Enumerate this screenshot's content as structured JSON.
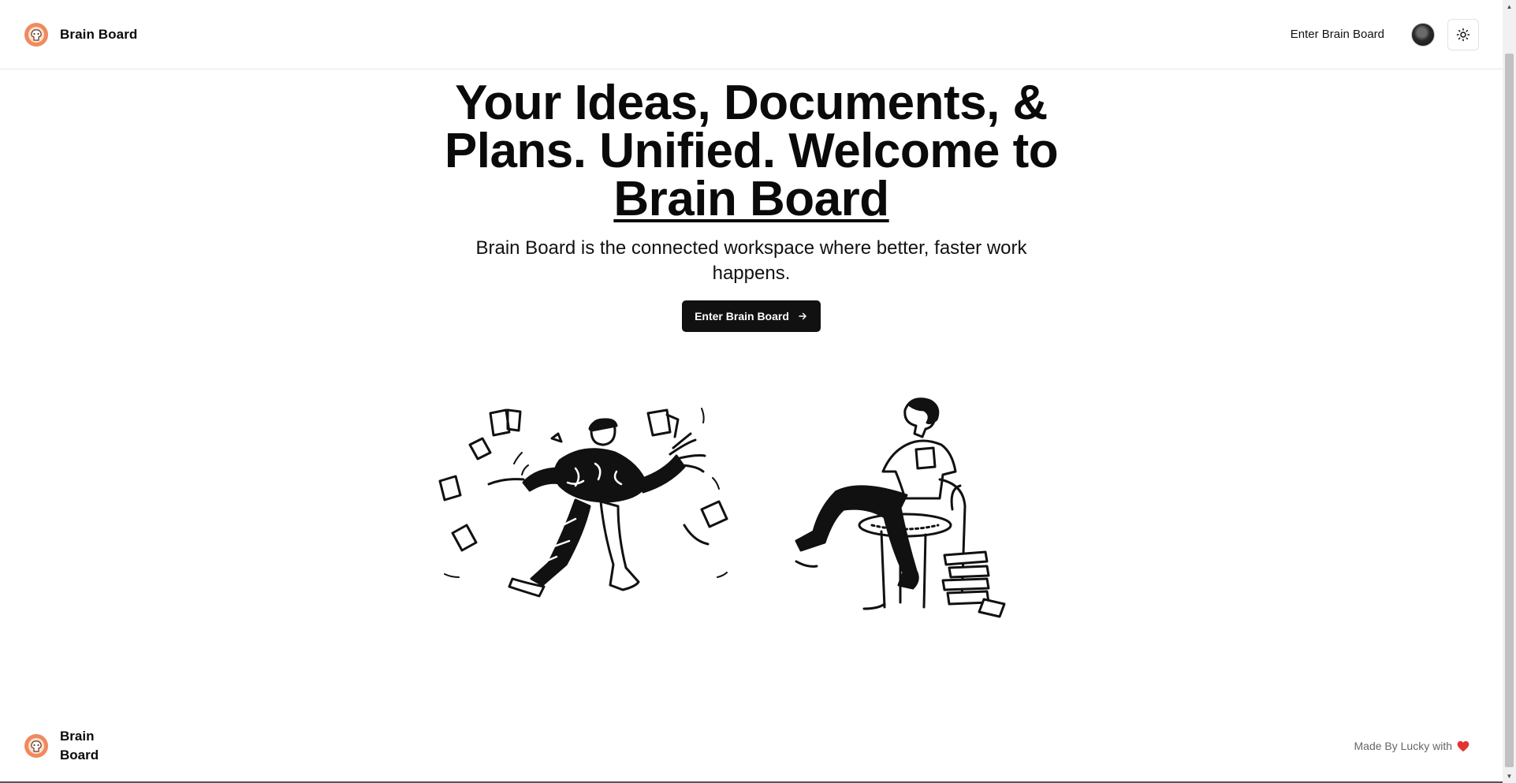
{
  "header": {
    "brand_name": "Brain Board",
    "nav_link": "Enter Brain Board"
  },
  "hero": {
    "title_main": "Your Ideas, Documents, & Plans. Unified. Welcome to ",
    "title_highlight": "Brain Board",
    "subtitle": "Brain Board is the connected workspace where better, faster work happens.",
    "cta_label": "Enter Brain Board"
  },
  "footer": {
    "brand_name": "Brain Board",
    "made_by": "Made By Lucky with"
  },
  "icons": {
    "logo": "brain-logo-icon",
    "theme": "sun-icon",
    "cta_arrow": "arrow-right-icon",
    "heart": "heart-icon"
  },
  "colors": {
    "accent_logo": "#f08a5d",
    "cta_bg": "#111111",
    "heart": "#e3342f"
  }
}
